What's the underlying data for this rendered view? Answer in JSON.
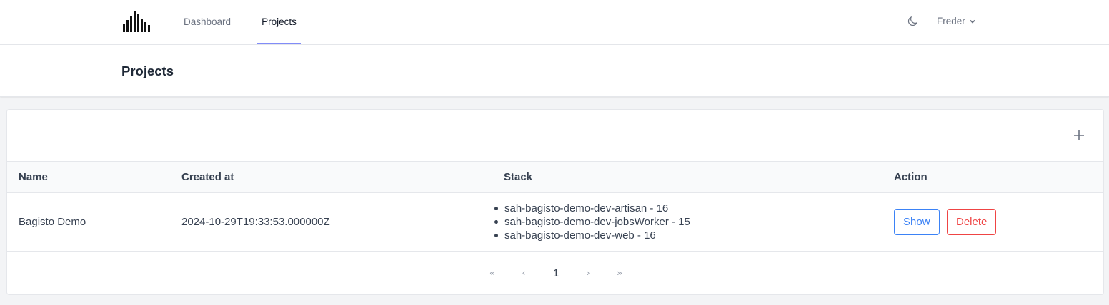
{
  "nav": {
    "links": [
      {
        "label": "Dashboard"
      },
      {
        "label": "Projects"
      }
    ],
    "user_name": "Freder"
  },
  "header": {
    "title": "Projects"
  },
  "table": {
    "columns": [
      "Name",
      "Created at",
      "Stack",
      "Action"
    ],
    "rows": [
      {
        "name": "Bagisto Demo",
        "created_at": "2024-10-29T19:33:53.000000Z",
        "stack": [
          "sah-bagisto-demo-dev-artisan - 16",
          "sah-bagisto-demo-dev-jobsWorker - 15",
          "sah-bagisto-demo-dev-web - 16"
        ],
        "actions": {
          "show": "Show",
          "delete": "Delete"
        }
      }
    ]
  },
  "pagination": {
    "first": "«",
    "prev": "‹",
    "current": "1",
    "next": "›",
    "last": "»"
  },
  "icons": {
    "logo": "bar-chart-logo-icon",
    "theme": "moon-icon",
    "user_menu": "chevron-down-icon",
    "add": "plus-icon"
  },
  "colors": {
    "active_underline": "#818cf8",
    "show_button": "#3b82f6",
    "delete_button": "#ef4444"
  }
}
